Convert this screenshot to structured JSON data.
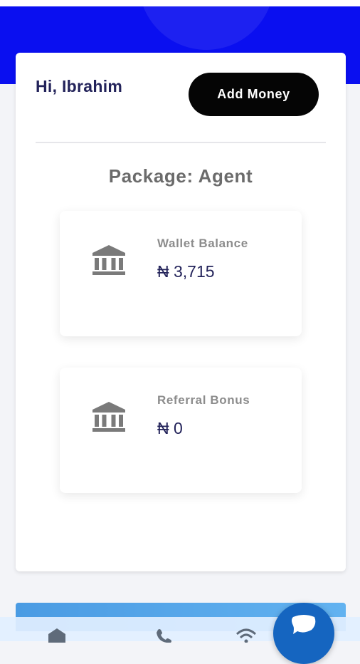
{
  "header": {
    "greeting": "Hi, Ibrahim",
    "add_money_label": "Add Money"
  },
  "package": {
    "label": "Package: Agent"
  },
  "cards": [
    {
      "label": "Wallet Balance",
      "value": "₦ 3,715",
      "icon": "bank-icon"
    },
    {
      "label": "Referral Bonus",
      "value": "₦ 0",
      "icon": "bank-icon"
    }
  ],
  "bottom_nav": {
    "icons": [
      "home-icon",
      "phone-icon",
      "wifi-icon"
    ],
    "fab_icon": "chat-icon"
  },
  "colors": {
    "primary_blue": "#0a0ff0",
    "button_black": "#050505",
    "text_navy": "#23235a",
    "fab_blue": "#1565c0"
  }
}
